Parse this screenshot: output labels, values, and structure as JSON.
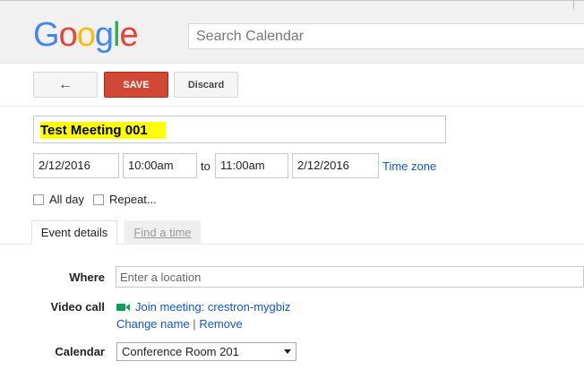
{
  "header": {
    "logo_letters": [
      {
        "ch": "G",
        "color": "#4285f4"
      },
      {
        "ch": "o",
        "color": "#ea4335"
      },
      {
        "ch": "o",
        "color": "#fbbc05"
      },
      {
        "ch": "g",
        "color": "#4285f4"
      },
      {
        "ch": "l",
        "color": "#34a853"
      },
      {
        "ch": "e",
        "color": "#ea4335"
      }
    ],
    "search_placeholder": "Search Calendar"
  },
  "toolbar": {
    "back_icon": "←",
    "save_label": "SAVE",
    "discard_label": "Discard"
  },
  "event": {
    "title": "Test Meeting 001",
    "start_date": "2/12/2016",
    "start_time": "10:00am",
    "to_label": "to",
    "end_time": "11:00am",
    "end_date": "2/12/2016",
    "time_zone_label": "Time zone",
    "all_day_label": "All day",
    "repeat_label": "Repeat..."
  },
  "tabs": {
    "event_details": "Event details",
    "find_a_time": "Find a time"
  },
  "details": {
    "where_label": "Where",
    "where_placeholder": "Enter a location",
    "video_call_label": "Video call",
    "join_meeting": "Join meeting: crestron-mygbiz",
    "change_name": "Change name",
    "separator": "|",
    "remove": "Remove",
    "calendar_label": "Calendar",
    "calendar_value": "Conference Room 201"
  },
  "colors": {
    "save_red": "#d14836",
    "link_blue": "#1155cc",
    "highlight_yellow": "#ffff00",
    "camera_green": "#0f9d58"
  }
}
